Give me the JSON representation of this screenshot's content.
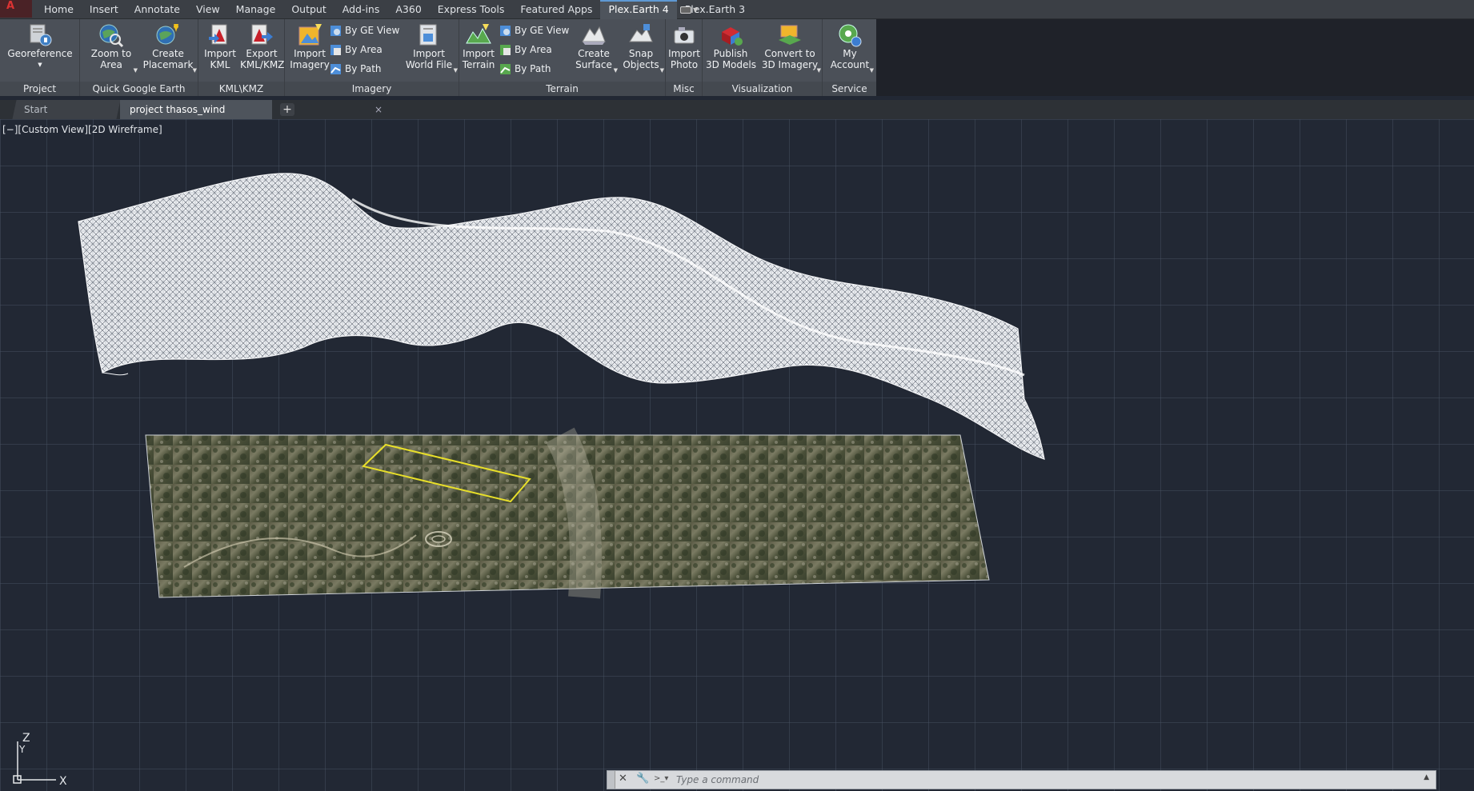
{
  "menu": {
    "tabs": [
      "Home",
      "Insert",
      "Annotate",
      "View",
      "Manage",
      "Output",
      "Add-ins",
      "A360",
      "Express Tools",
      "Featured Apps",
      "Plex.Earth 4",
      "Plex.Earth 3"
    ],
    "active_index": 10
  },
  "ribbon": {
    "project": {
      "title": "Project",
      "georeference": "Georeference"
    },
    "quick_google_earth": {
      "title": "Quick Google Earth",
      "zoom_to_area_1": "Zoom to",
      "zoom_to_area_2": "Area",
      "create_placemark_1": "Create",
      "create_placemark_2": "Placemark"
    },
    "kml": {
      "title": "KML\\KMZ",
      "import_kml_1": "Import",
      "import_kml_2": "KML",
      "export_kml_1": "Export",
      "export_kml_2": "KML/KMZ"
    },
    "imagery": {
      "title": "Imagery",
      "import_imagery_1": "Import",
      "import_imagery_2": "Imagery",
      "by_ge_view": "By GE View",
      "by_area": "By Area",
      "by_path": "By Path",
      "import_world_file_1": "Import",
      "import_world_file_2": "World File"
    },
    "terrain": {
      "title": "Terrain",
      "import_terrain_1": "Import",
      "import_terrain_2": "Terrain",
      "by_ge_view": "By GE View",
      "by_area": "By Area",
      "by_path": "By Path",
      "create_surface_1": "Create",
      "create_surface_2": "Surface",
      "snap_objects_1": "Snap",
      "snap_objects_2": "Objects"
    },
    "misc": {
      "title": "Misc",
      "import_photo_1": "Import",
      "import_photo_2": "Photo"
    },
    "visualization": {
      "title": "Visualization",
      "publish_1": "Publish",
      "publish_2": "3D Models",
      "convert_1": "Convert to",
      "convert_2": "3D Imagery"
    },
    "service": {
      "title": "Service",
      "my_account_1": "My",
      "my_account_2": "Account"
    }
  },
  "doc_tabs": {
    "start": "Start",
    "project": "project thasos_wind turbines*",
    "close": "×",
    "add": "+"
  },
  "viewport": {
    "label": "[−][Custom View][2D Wireframe]"
  },
  "ucs": {
    "z": "Z",
    "y": "Y",
    "x": "X"
  },
  "command_line": {
    "placeholder": "Type a command"
  },
  "colors": {
    "accent": "#5e98d3",
    "selection": "#e8df2a",
    "background": "#222834"
  }
}
